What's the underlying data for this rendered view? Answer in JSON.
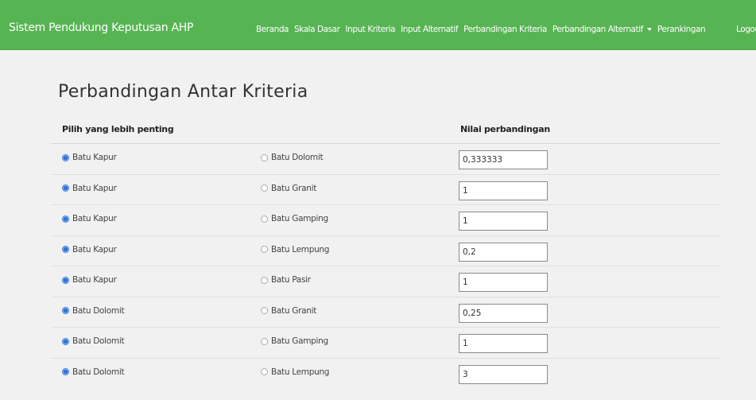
{
  "app": {
    "brand": "Sistem Pendukung Keputusan AHP"
  },
  "nav": {
    "items": [
      "Beranda",
      "Skala Dasar",
      "Input Kriteria",
      "Input Alternatif",
      "Perbandingan Kriteria",
      "Perbandingan Alternatif",
      "Perankingan"
    ],
    "logout": "Logout"
  },
  "page": {
    "title": "Perbandingan Antar Kriteria",
    "col_choose": "Pilih yang lebih penting",
    "col_value": "Nilai perbandingan"
  },
  "rows": [
    {
      "left": "Batu Kapur",
      "right": "Batu Dolomit",
      "value": "0,333333",
      "selected": "left"
    },
    {
      "left": "Batu Kapur",
      "right": "Batu Granit",
      "value": "1",
      "selected": "left"
    },
    {
      "left": "Batu Kapur",
      "right": "Batu Gamping",
      "value": "1",
      "selected": "left"
    },
    {
      "left": "Batu Kapur",
      "right": "Batu Lempung",
      "value": "0,2",
      "selected": "left"
    },
    {
      "left": "Batu Kapur",
      "right": "Batu Pasir",
      "value": "1",
      "selected": "left"
    },
    {
      "left": "Batu Dolomit",
      "right": "Batu Granit",
      "value": "0,25",
      "selected": "left"
    },
    {
      "left": "Batu Dolomit",
      "right": "Batu Gamping",
      "value": "1",
      "selected": "left"
    },
    {
      "left": "Batu Dolomit",
      "right": "Batu Lempung",
      "value": "3",
      "selected": "left"
    }
  ],
  "colors": {
    "navbar": "#57b453",
    "radio_checked": "#2f74d6",
    "page_bg": "#f1f1f1"
  }
}
